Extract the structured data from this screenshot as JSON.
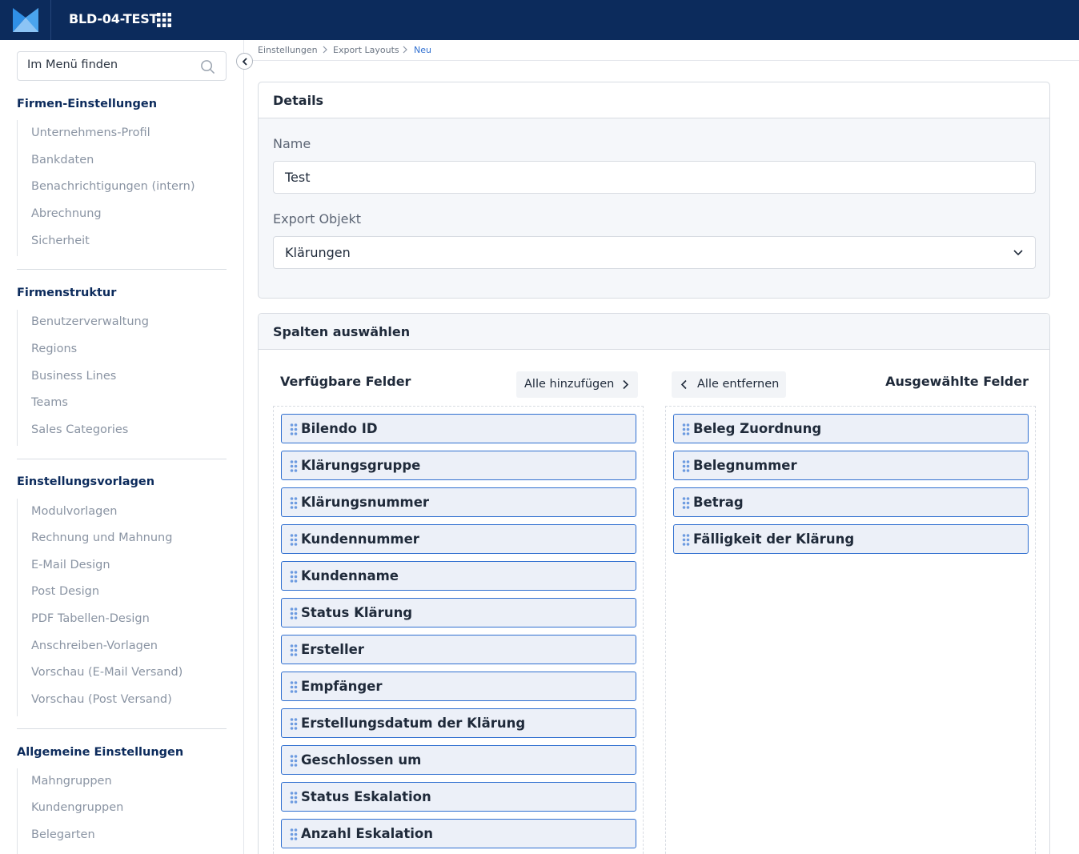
{
  "app": {
    "title": "BLD-04-TEST"
  },
  "search": {
    "placeholder": "Im Menü finden"
  },
  "sidebar": {
    "sections": [
      {
        "title": "Firmen-Einstellungen",
        "items": [
          "Unternehmens-Profil",
          "Bankdaten",
          "Benachrichtigungen (intern)",
          "Abrechnung",
          "Sicherheit"
        ]
      },
      {
        "title": "Firmenstruktur",
        "items": [
          "Benutzerverwaltung",
          "Regions",
          "Business Lines",
          "Teams",
          "Sales Categories"
        ]
      },
      {
        "title": "Einstellungsvorlagen",
        "items": [
          "Modulvorlagen",
          "Rechnung und Mahnung",
          "E-Mail Design",
          "Post Design",
          "PDF Tabellen-Design",
          "Anschreiben-Vorlagen",
          "Vorschau (E-Mail Versand)",
          "Vorschau (Post Versand)"
        ]
      },
      {
        "title": "Allgemeine Einstellungen",
        "items": [
          "Mahngruppen",
          "Kundengruppen",
          "Belegarten"
        ]
      }
    ]
  },
  "breadcrumb": [
    "Einstellungen",
    "Export Layouts",
    "Neu"
  ],
  "details": {
    "title": "Details",
    "name_label": "Name",
    "name_value": "Test",
    "object_label": "Export Objekt",
    "object_value": "Klärungen"
  },
  "columns": {
    "title": "Spalten auswählen",
    "available_title": "Verfügbare Felder",
    "selected_title": "Ausgewählte Felder",
    "add_all": "Alle hinzufügen",
    "remove_all": "Alle entfernen",
    "available": [
      "Bilendo ID",
      "Klärungsgruppe",
      "Klärungsnummer",
      "Kundennummer",
      "Kundenname",
      "Status Klärung",
      "Ersteller",
      "Empfänger",
      "Erstellungsdatum der Klärung",
      "Geschlossen um",
      "Status Eskalation",
      "Anzahl Eskalation"
    ],
    "selected": [
      "Beleg Zuordnung",
      "Belegnummer",
      "Betrag",
      "Fälligkeit der Klärung"
    ]
  },
  "colors": {
    "navy": "#0c2b5c",
    "accent": "#2f6fd0",
    "item_bg": "#ecf0f8"
  }
}
